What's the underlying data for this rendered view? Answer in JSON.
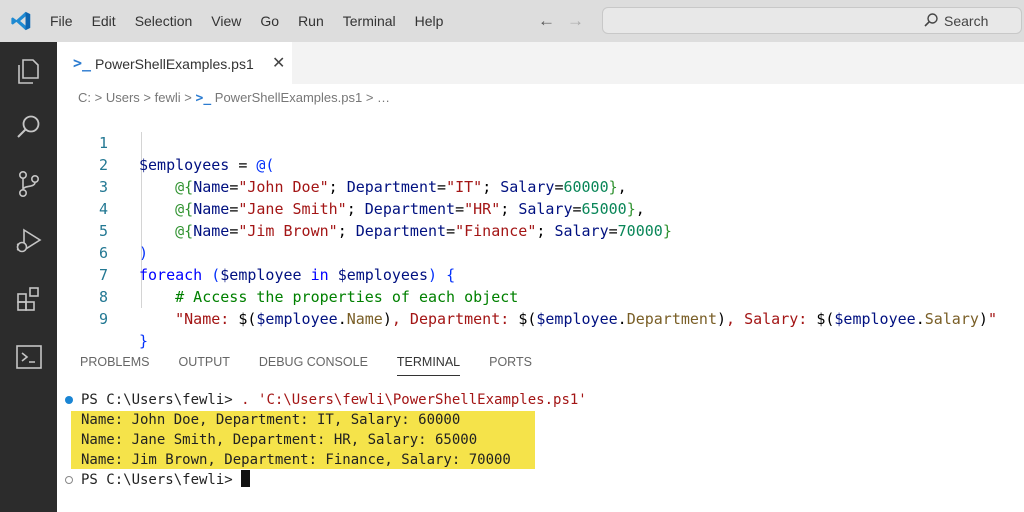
{
  "menu": [
    "File",
    "Edit",
    "Selection",
    "View",
    "Go",
    "Run",
    "Terminal",
    "Help"
  ],
  "search": {
    "label": "Search"
  },
  "tab": {
    "label": "PowerShellExamples.ps1",
    "close": "✕"
  },
  "breadcrumb": [
    "C:",
    "Users",
    "fewli",
    "PowerShellExamples.ps1",
    "…"
  ],
  "editor": {
    "line_numbers": [
      "1",
      "2",
      "3",
      "4",
      "5",
      "6",
      "7",
      "8",
      "9"
    ]
  },
  "panel_tabs": [
    "PROBLEMS",
    "OUTPUT",
    "DEBUG CONSOLE",
    "TERMINAL",
    "PORTS"
  ],
  "terminal": {
    "command_prompt": "PS C:\\Users\\fewli> ",
    "command": ". 'C:\\Users\\fewli\\PowerShellExamples.ps1'",
    "output": [
      "Name: John Doe, Department: IT, Salary: 60000",
      "Name: Jane Smith, Department: HR, Salary: 65000",
      "Name: Jim Brown, Department: Finance, Salary: 70000"
    ],
    "prompt": "PS C:\\Users\\fewli> "
  },
  "colors": {
    "accent": "#007acc",
    "highlight": "#f5e34a",
    "activity_bar": "#2c2c2c"
  }
}
